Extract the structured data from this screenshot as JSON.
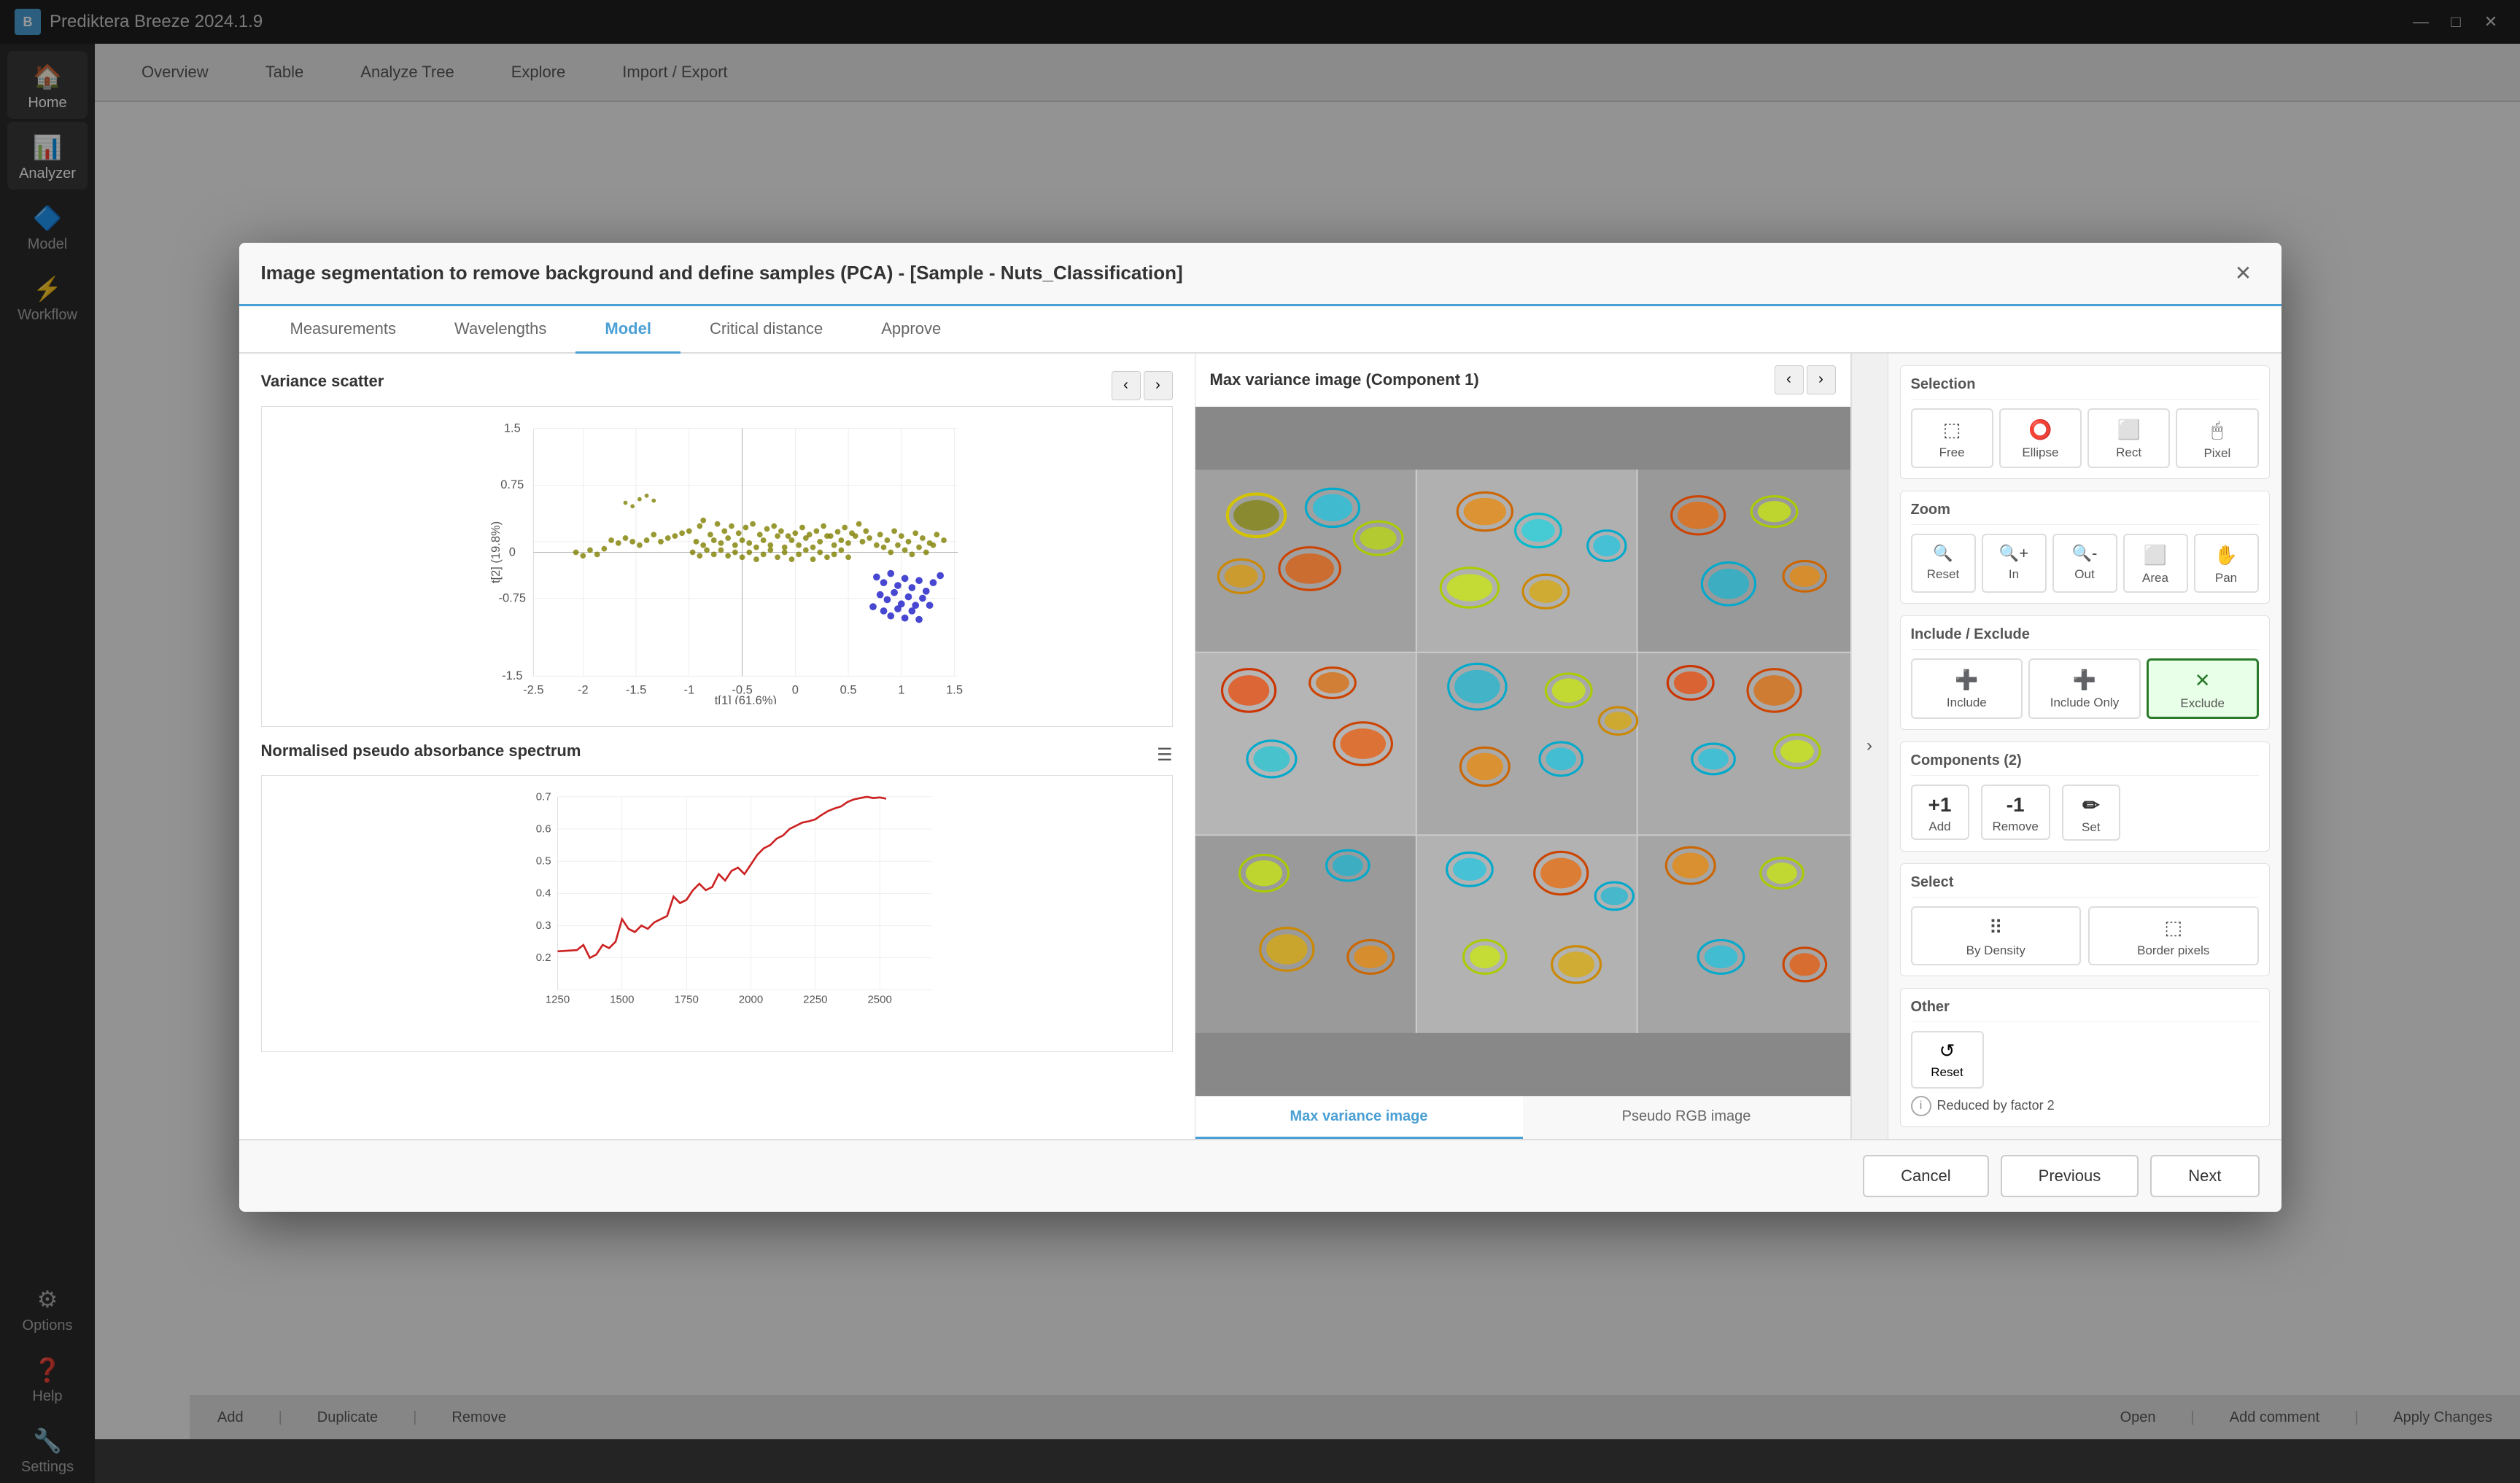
{
  "app": {
    "title": "Prediktera Breeze 2024.1.9"
  },
  "titlebar": {
    "minimize": "—",
    "maximize": "□",
    "close": "✕"
  },
  "sidebar": {
    "items": [
      {
        "id": "home",
        "icon": "🏠",
        "label": "Home"
      },
      {
        "id": "analyzer",
        "icon": "📊",
        "label": "Analyzer"
      },
      {
        "id": "model",
        "icon": "🔷",
        "label": "Model"
      },
      {
        "id": "workflow",
        "icon": "⚡",
        "label": "Workflow"
      },
      {
        "id": "options",
        "icon": "⚙",
        "label": "Options"
      },
      {
        "id": "help",
        "icon": "❓",
        "label": "Help"
      },
      {
        "id": "settings",
        "icon": "🔧",
        "label": "Settings"
      }
    ]
  },
  "topnav": {
    "items": [
      "Overview",
      "Table",
      "Analyze Tree",
      "Explore",
      "Import / Export"
    ]
  },
  "statusbar": {
    "items": [
      "Add",
      "Duplicate",
      "Remove",
      "Open",
      "Add comment",
      "Apply Changes"
    ]
  },
  "modal": {
    "title": "Image segmentation to remove background and define samples (PCA) - [Sample - Nuts_Classification]",
    "tabs": [
      "Measurements",
      "Wavelengths",
      "Model",
      "Critical distance",
      "Approve"
    ],
    "active_tab": "Model",
    "scatter": {
      "title": "Variance scatter",
      "x_label": "t[1] (61.6%)",
      "y_label": "t[2] (19.8%)",
      "x_axis": [
        -2.5,
        -2,
        -1.5,
        -1,
        -0.5,
        0,
        0.5,
        1,
        1.5
      ],
      "y_axis": [
        -1.5,
        -0.75,
        0,
        0.75,
        1.5
      ]
    },
    "image": {
      "title": "Max variance image (Component  1)",
      "tabs": [
        "Max variance image",
        "Pseudo RGB image"
      ],
      "active_tab": "Max variance image"
    },
    "spectrum": {
      "title": "Normalised pseudo absorbance spectrum",
      "x_axis": [
        1250,
        1500,
        1750,
        2000,
        2250,
        2500
      ],
      "y_axis": [
        0.2,
        0.3,
        0.4,
        0.5,
        0.6,
        0.7
      ]
    },
    "controls": {
      "selection": {
        "title": "Selection",
        "buttons": [
          {
            "id": "free",
            "icon": "⬚",
            "label": "Free"
          },
          {
            "id": "ellipse",
            "icon": "⭕",
            "label": "Ellipse"
          },
          {
            "id": "rect",
            "icon": "⬜",
            "label": "Rect"
          },
          {
            "id": "pixel",
            "icon": "🖱",
            "label": "Pixel"
          }
        ]
      },
      "zoom": {
        "title": "Zoom",
        "buttons": [
          {
            "id": "reset",
            "icon": "🔍",
            "label": "Reset"
          },
          {
            "id": "in",
            "icon": "🔍",
            "label": "In"
          },
          {
            "id": "out",
            "icon": "🔍",
            "label": "Out"
          },
          {
            "id": "area",
            "icon": "⬜",
            "label": "Area"
          },
          {
            "id": "pan",
            "icon": "✋",
            "label": "Pan"
          }
        ]
      },
      "include_exclude": {
        "title": "Include / Exclude",
        "buttons": [
          {
            "id": "include",
            "icon": "➕",
            "label": "Include"
          },
          {
            "id": "include_only",
            "icon": "➕",
            "label": "Include Only"
          },
          {
            "id": "exclude",
            "icon": "✕",
            "label": "Exclude"
          }
        ],
        "active": "exclude"
      },
      "components": {
        "title": "Components (2)",
        "buttons": [
          {
            "id": "add",
            "icon": "+1",
            "label": "Add"
          },
          {
            "id": "remove",
            "icon": "-1",
            "label": "Remove"
          },
          {
            "id": "set",
            "icon": "✏",
            "label": "Set"
          }
        ]
      },
      "select": {
        "title": "Select",
        "buttons": [
          {
            "id": "by_density",
            "icon": "⠿",
            "label": "By Density"
          },
          {
            "id": "border_pixels",
            "icon": "⬚",
            "label": "Border pixels"
          }
        ]
      },
      "other": {
        "title": "Other",
        "reset_label": "Reset",
        "info_label": "Reduced by factor 2"
      }
    },
    "footer": {
      "cancel": "Cancel",
      "previous": "Previous",
      "next": "Next"
    }
  }
}
